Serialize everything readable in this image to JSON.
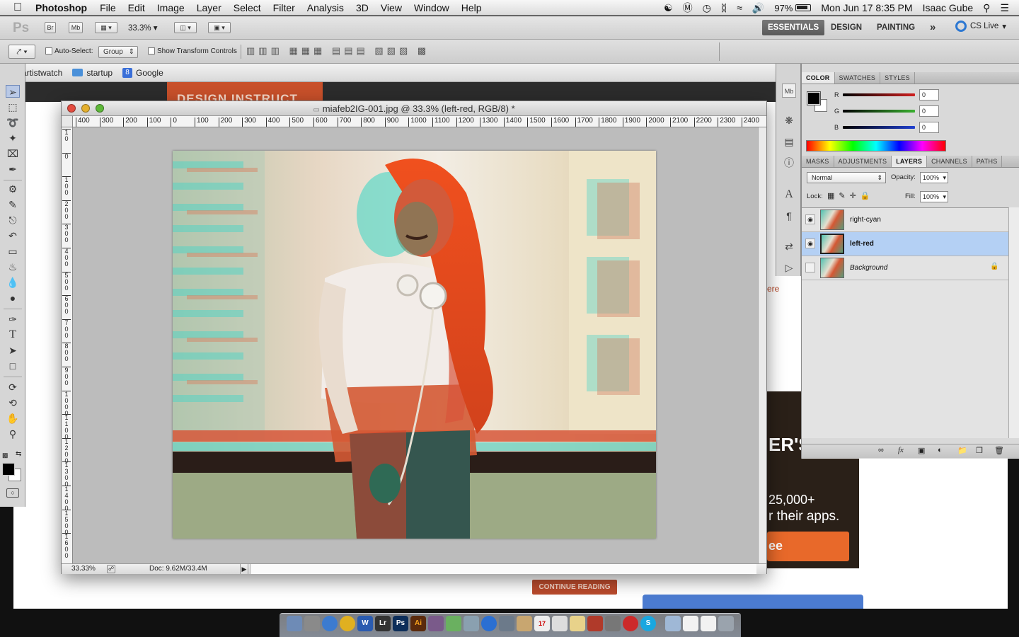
{
  "menubar": {
    "app_name": "Photoshop",
    "items": [
      "File",
      "Edit",
      "Image",
      "Layer",
      "Select",
      "Filter",
      "Analysis",
      "3D",
      "View",
      "Window",
      "Help"
    ],
    "battery": "97%",
    "clock": "Mon Jun 17  8:35 PM",
    "user": "Isaac Gube"
  },
  "appbar": {
    "logo": "Ps",
    "bridge": "Br",
    "minibridge": "Mb",
    "zoom": "33.3%",
    "workspaces": [
      "ESSENTIALS",
      "DESIGN",
      "PAINTING"
    ],
    "more": "»",
    "cs_live": "CS Live"
  },
  "options": {
    "auto_select_label": "Auto-Select:",
    "auto_select_value": "Group",
    "transform_label": "Show Transform Controls"
  },
  "browser": {
    "bookmarks": [
      "artistwatch",
      "startup",
      "Google"
    ],
    "banner_text": "DESIGN INSTRUCT",
    "side_text": "ere",
    "ad_line1": "ER'S",
    "ad_line2": "25,000+",
    "ad_line3": "r their apps.",
    "ad_button": "ee",
    "continue": "CONTINUE READING"
  },
  "document": {
    "title": "miafeb2IG-001.jpg @ 33.3% (left-red, RGB/8) *",
    "zoom": "33.33%",
    "doc_size": "Doc: 9.62M/33.4M",
    "hruler": [
      "400",
      "300",
      "200",
      "100",
      "0",
      "100",
      "200",
      "300",
      "400",
      "500",
      "600",
      "700",
      "800",
      "900",
      "1000",
      "1100",
      "1200",
      "1300",
      "1400",
      "1500",
      "1600",
      "1700",
      "1800",
      "1900",
      "2000",
      "2100",
      "2200",
      "2300",
      "2400"
    ],
    "vruler": [
      "1 0",
      "0",
      "1 0 0",
      "2 0 0",
      "3 0 0",
      "4 0 0",
      "5 0 0",
      "6 0 0",
      "7 0 0",
      "8 0 0",
      "9 0 0",
      "1 0 0 0",
      "1 1 0 0",
      "1 2 0 0",
      "1 3 0 0",
      "1 4 0 0",
      "1 5 0 0",
      "1 6 0 0"
    ]
  },
  "color_panel": {
    "tabs": [
      "COLOR",
      "SWATCHES",
      "STYLES"
    ],
    "channels": [
      {
        "label": "R",
        "value": "0",
        "color": "#d02020"
      },
      {
        "label": "G",
        "value": "0",
        "color": "#3ab030"
      },
      {
        "label": "B",
        "value": "0",
        "color": "#2040d0"
      }
    ]
  },
  "layers_panel": {
    "tabs": [
      "MASKS",
      "ADJUSTMENTS",
      "LAYERS",
      "CHANNELS",
      "PATHS"
    ],
    "blend_mode": "Normal",
    "opacity_label": "Opacity:",
    "opacity": "100%",
    "lock_label": "Lock:",
    "fill_label": "Fill:",
    "fill": "100%",
    "layers": [
      {
        "name": "right-cyan",
        "visible": true,
        "selected": false
      },
      {
        "name": "left-red",
        "visible": true,
        "selected": true
      },
      {
        "name": "Background",
        "visible": false,
        "selected": false
      }
    ]
  },
  "colors": {
    "accent": "#4a90d9",
    "selection": "#b4d0f4",
    "anaglyph_red": "#e4502a",
    "anaglyph_cyan": "#4fd6c6"
  }
}
